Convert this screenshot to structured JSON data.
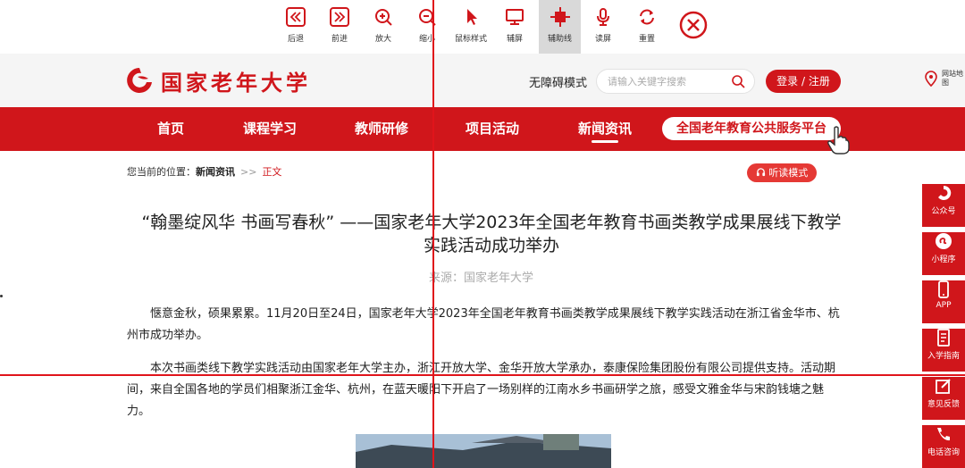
{
  "toolbar": {
    "items": [
      {
        "label": "后退",
        "icon": "back-icon"
      },
      {
        "label": "前进",
        "icon": "forward-icon"
      },
      {
        "label": "放大",
        "icon": "zoom-in-icon"
      },
      {
        "label": "缩小",
        "icon": "zoom-out-icon"
      },
      {
        "label": "鼠标样式",
        "icon": "cursor-icon"
      },
      {
        "label": "辅屏",
        "icon": "monitor-icon"
      },
      {
        "label": "辅助线",
        "icon": "crosshair-icon",
        "active": true
      },
      {
        "label": "读屏",
        "icon": "microphone-icon"
      },
      {
        "label": "重置",
        "icon": "reset-icon"
      }
    ],
    "close_icon": "close-circle-icon"
  },
  "header": {
    "logo_text": "国家老年大学",
    "a11y_mode": "无障碍模式",
    "search_placeholder": "请输入关键字搜索",
    "login_label": "登录 / 注册",
    "sitemap_label": "网站地图"
  },
  "nav": {
    "items": [
      "首页",
      "课程学习",
      "教师研修",
      "项目活动",
      "新闻资讯"
    ],
    "active_index": 4,
    "platform_label": "全国老年教育公共服务平台"
  },
  "breadcrumb": {
    "prefix": "您当前的位置：",
    "section": "新闻资讯",
    "separator": ">>",
    "current": "正文"
  },
  "listen_mode": "听读模式",
  "article": {
    "title": "“翰墨绽风华 书画写春秋” ——国家老年大学2023年全国老年教育书画类教学成果展线下教学实践活动成功举办",
    "source": "来源：国家老年大学",
    "paragraphs": [
      "惬意金秋，硕果累累。11月20日至24日，国家老年大学2023年全国老年教育书画类教学成果展线下教学实践活动在浙江省金华市、杭州市成功举办。",
      "本次书画类线下教学实践活动由国家老年大学主办，浙江开放大学、金华开放大学承办，泰康保险集团股份有限公司提供支持。活动期间，来自全国各地的学员们相聚浙江金华、杭州，在蓝天暖阳下开启了一场别样的江南水乡书画研学之旅，感受文雅金华与宋韵钱塘之魅力。"
    ]
  },
  "float_bar": [
    {
      "label": "公众号",
      "icon": "wechat-icon"
    },
    {
      "label": "小程序",
      "icon": "mini-program-icon"
    },
    {
      "label": "APP",
      "icon": "phone-icon"
    },
    {
      "label": "入学指南",
      "icon": "guide-icon"
    },
    {
      "label": "意见反馈",
      "icon": "feedback-icon"
    },
    {
      "label": "电话咨询",
      "icon": "telephone-icon"
    }
  ],
  "colors": {
    "brand_red": "#d0161b",
    "guide_line": "#e0141b"
  }
}
